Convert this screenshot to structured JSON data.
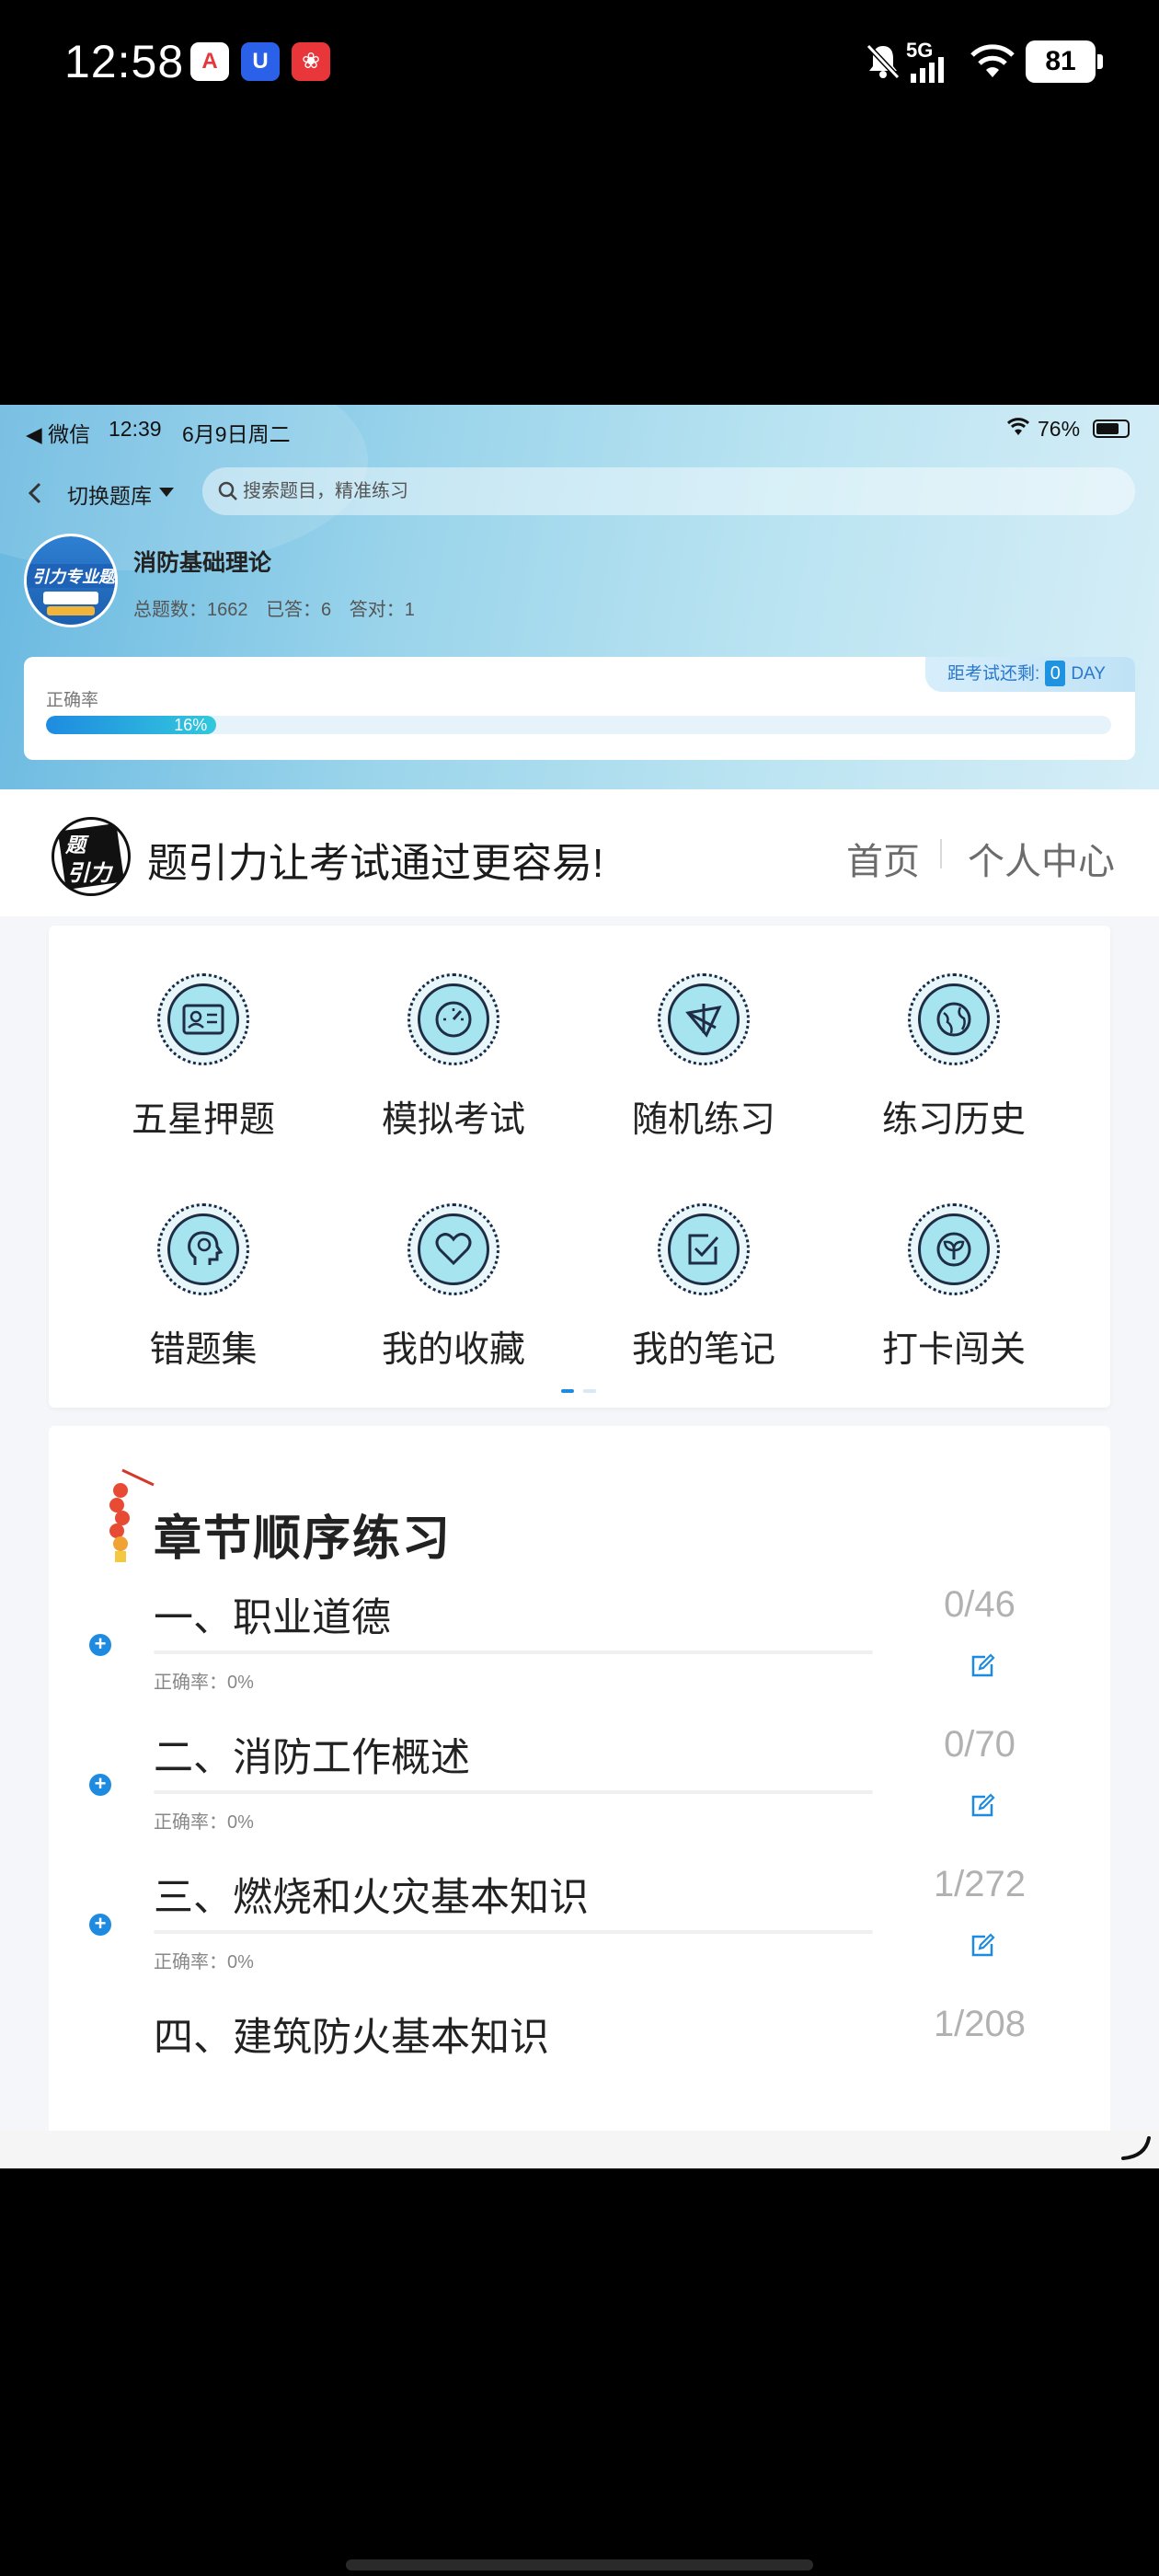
{
  "phone_status": {
    "time": "12:58",
    "network": "5G",
    "battery": "81",
    "apps": [
      "A",
      "U",
      "❀"
    ]
  },
  "inner_status": {
    "back_app": "◀ 微信",
    "time": "12:39",
    "date": "6月9日周二",
    "battery": "76%"
  },
  "topbar": {
    "switch_label": "切换题库",
    "search_placeholder": "搜索题目，精准练习"
  },
  "subject": {
    "title": "消防基础理论",
    "total_label": "总题数：1662",
    "answered_label": "已答：6",
    "correct_label": "答对：1",
    "avatar_text": "引力专业题"
  },
  "accuracy": {
    "label": "正确率",
    "percent_text": "16%",
    "percent_value": 16,
    "countdown_label": "距考试还剩:",
    "countdown_days": "0",
    "countdown_unit": "DAY"
  },
  "brand": {
    "logo_line1": "题",
    "logo_line2": "引力",
    "slogan": "题引力让考试通过更容易!",
    "nav_home": "首页",
    "nav_profile": "个人中心"
  },
  "functions": [
    {
      "label": "五星押题",
      "icon": "id-card-icon"
    },
    {
      "label": "模拟考试",
      "icon": "gauge-icon"
    },
    {
      "label": "随机练习",
      "icon": "shuffle-icon"
    },
    {
      "label": "练习历史",
      "icon": "globe-icon"
    },
    {
      "label": "错题集",
      "icon": "head-icon"
    },
    {
      "label": "我的收藏",
      "icon": "heart-icon"
    },
    {
      "label": "我的笔记",
      "icon": "check-note-icon"
    },
    {
      "label": "打卡闯关",
      "icon": "sprout-icon"
    }
  ],
  "chapters": {
    "heading": "章节顺序练习",
    "items": [
      {
        "title": "一、职业道德",
        "count": "0/46",
        "accuracy": "正确率：0%"
      },
      {
        "title": "二、消防工作概述",
        "count": "0/70",
        "accuracy": "正确率：0%"
      },
      {
        "title": "三、燃烧和火灾基本知识",
        "count": "1/272",
        "accuracy": "正确率：0%"
      },
      {
        "title": "四、建筑防火基本知识",
        "count": "1/208",
        "accuracy": ""
      }
    ]
  },
  "colors": {
    "accent": "#1f8be0",
    "hero_start": "#68b8e0",
    "hero_end": "#d6eef7"
  }
}
